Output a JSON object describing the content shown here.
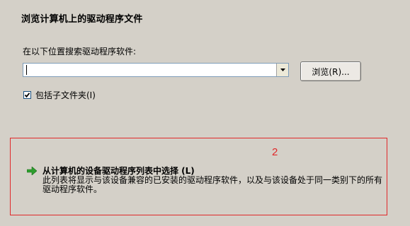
{
  "dialog": {
    "heading": "浏览计算机上的驱动程序文件",
    "search_label": "在以下位置搜索驱动程序软件:",
    "path_value": "",
    "browse_label": "浏览(R)...",
    "include_subfolders_label": "包括子文件夹(I)",
    "include_subfolders_checked": true
  },
  "pick_option": {
    "title": "从计算机的设备驱动程序列表中选择 (L)",
    "description": "此列表将显示与该设备兼容的已安装的驱动程序软件，以及与该设备处于同一类别下的所有驱动程序软件。",
    "icon": "green-arrow-icon"
  },
  "annotation": {
    "number": "2",
    "color": "#e0282a"
  }
}
